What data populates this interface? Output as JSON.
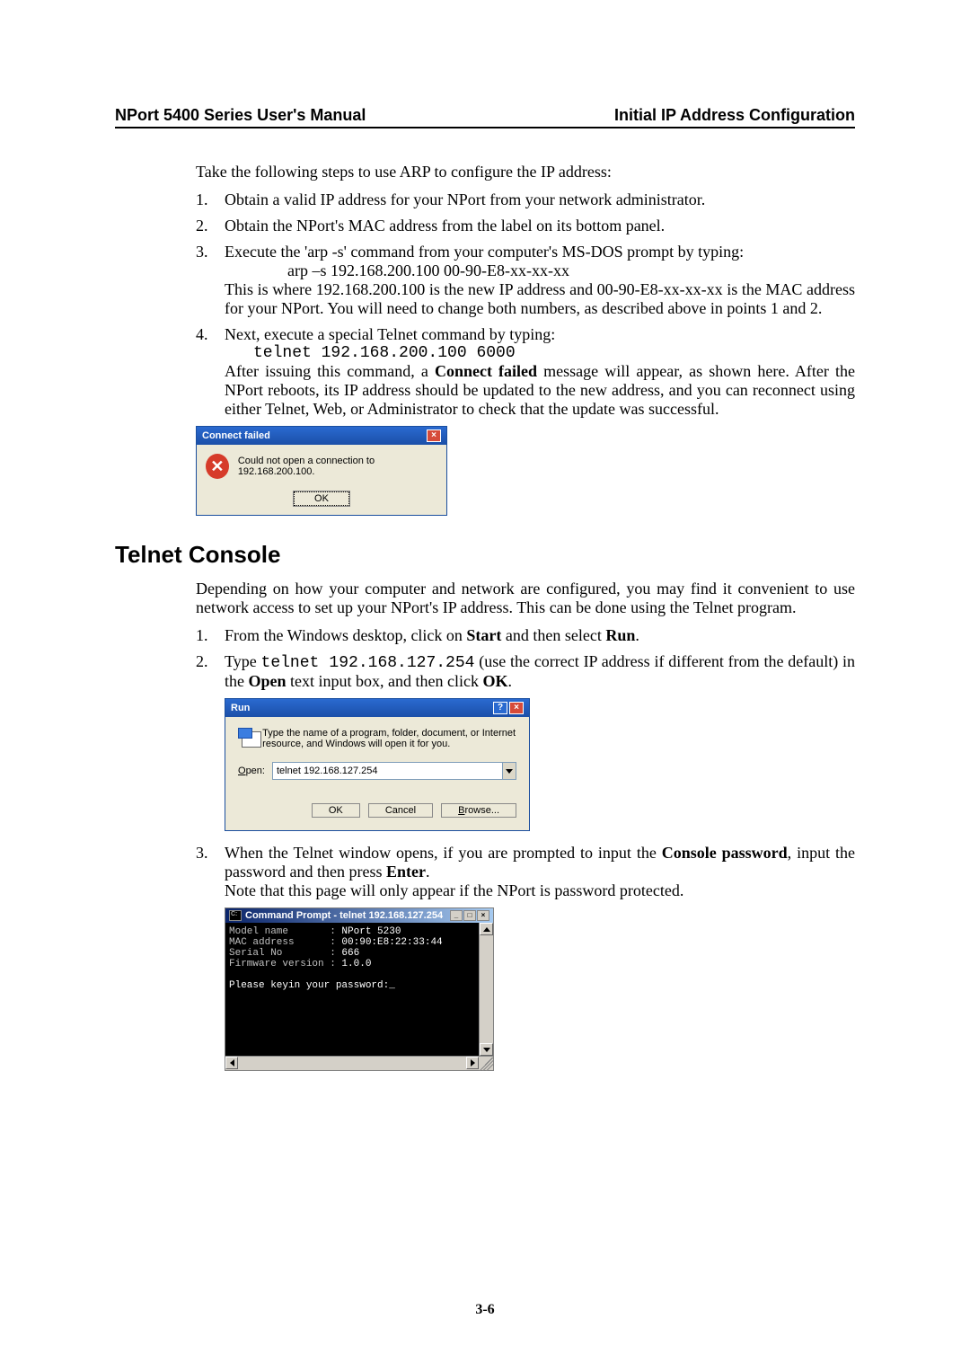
{
  "header": {
    "left": "NPort 5400 Series User's Manual",
    "right": "Initial IP Address Configuration"
  },
  "intro": "Take the following steps to use ARP to configure the IP address:",
  "steps_a": {
    "s1": {
      "num": "1.",
      "text": "Obtain a valid IP address for your NPort from your network administrator."
    },
    "s2": {
      "num": "2.",
      "text": "Obtain the NPort's MAC address from the label on its bottom panel."
    },
    "s3": {
      "num": "3.",
      "line1": "Execute the 'arp -s' command from your computer's MS-DOS prompt by typing:",
      "cmd": "arp –s 192.168.200.100 00-90-E8-xx-xx-xx",
      "para": "This is where 192.168.200.100 is the new IP address and 00-90-E8-xx-xx-xx is the MAC address for your NPort. You will need to change both numbers, as described above in points 1 and 2."
    },
    "s4": {
      "num": "4.",
      "line1": "Next, execute a special Telnet command by typing:",
      "cmd": "telnet 192.168.200.100 6000",
      "para_pre": "After issuing this command, a ",
      "para_bold": "Connect failed",
      "para_post": " message will appear, as shown here. After the NPort reboots, its IP address should be updated to the new address, and you can reconnect using either Telnet, Web, or Administrator to check that the update was successful."
    }
  },
  "dlg_connect": {
    "title": "Connect failed",
    "msg": "Could not open a connection to 192.168.200.100.",
    "ok": "OK"
  },
  "section_title": "Telnet Console",
  "telnet_intro": "Depending on how your computer and network are configured, you may find it convenient to use network access to set up your NPort's IP address. This can be done using the Telnet program.",
  "steps_b": {
    "s1": {
      "num": "1.",
      "pre": "From the Windows desktop, click on ",
      "b1": "Start",
      "mid": " and then select ",
      "b2": "Run",
      "post": "."
    },
    "s2": {
      "num": "2.",
      "pre": "Type ",
      "cmd": "telnet 192.168.127.254",
      "mid": " (use the correct IP address if different from the default) in the ",
      "b1": "Open",
      "mid2": " text input box, and then click ",
      "b2": "OK",
      "post": "."
    },
    "s3": {
      "num": "3.",
      "pre": "When the Telnet window opens, if you are prompted to input the ",
      "b1": "Console password",
      "mid": ", input the password and then press ",
      "b2": "Enter",
      "post": ".",
      "note": "Note that this page will only appear if the NPort is password protected."
    }
  },
  "dlg_run": {
    "title": "Run",
    "desc": "Type the name of a program, folder, document, or Internet resource, and Windows will open it for you.",
    "open_label_u": "O",
    "open_label_rest": "pen:",
    "open_value": "telnet 192.168.127.254",
    "btn_ok": "OK",
    "btn_cancel": "Cancel",
    "btn_browse_u": "B",
    "btn_browse_rest": "rowse..."
  },
  "cmd": {
    "title": "Command Prompt - telnet 192.168.127.254",
    "line1a": "Model name       : ",
    "line1b": "NPort 5230",
    "line2a": "MAC address      : ",
    "line2b": "00:90:E8:22:33:44",
    "line3a": "Serial No        : ",
    "line3b": "666",
    "line4a": "Firmware version : ",
    "line4b": "1.0.0",
    "prompt": "Please keyin your password:_"
  },
  "page_num": "3-6"
}
